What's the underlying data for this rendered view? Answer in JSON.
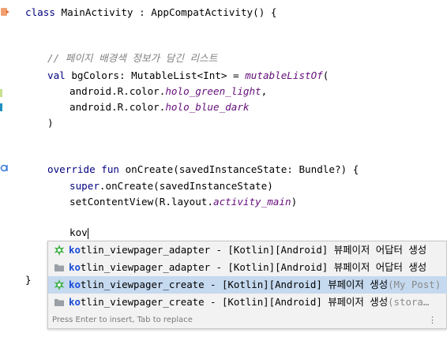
{
  "code": {
    "line_class": "class MainActivity : AppCompatActivity() {",
    "class_kw": "class",
    "class_rest": " MainActivity : AppCompatActivity() {",
    "comment": "// 페이지 배경색 정보가 담긴 리스트",
    "val_kw": "val",
    "val_rest": " bgColors: MutableList<Int> = ",
    "val_fn": "mutableListOf",
    "val_paren": "(",
    "color1_prefix": "android.R.color.",
    "color1_field": "holo_green_light",
    "color1_suffix": ",",
    "color2_prefix": "android.R.color.",
    "color2_field": "holo_blue_dark",
    "close_paren": ")",
    "override_kw": "override fun",
    "override_rest": " onCreate(savedInstanceState: Bundle?) {",
    "super_kw": "super",
    "super_rest": ".onCreate(savedInstanceState)",
    "setcontent_prefix": "setContentView(R.layout.",
    "setcontent_field": "activity_main",
    "setcontent_suffix": ")",
    "typed": "kov",
    "close_brace": "}"
  },
  "autocomplete": {
    "items": [
      {
        "match": "ko",
        "text": "tlin_viewpager_adapter - [Kotlin][Android] 뷰페이저 어답터 생성",
        "tail": "",
        "icon": "live-template-icon",
        "selected": false
      },
      {
        "match": "ko",
        "text": "tlin_viewpager_adapter - [Kotlin][Android] 뷰페이저 어답터 생성",
        "tail": "",
        "icon": "folder-icon",
        "selected": false
      },
      {
        "match": "ko",
        "text": "tlin_viewpager_create - [Kotlin][Android] 뷰페이저 생성",
        "tail": "(My Post)",
        "icon": "live-template-icon",
        "selected": true
      },
      {
        "match": "ko",
        "text": "tlin_viewpager_create - [Kotlin][Android] 뷰페이저 생성",
        "tail": "(stora…",
        "icon": "folder-icon",
        "selected": false
      }
    ],
    "hint": "Press Enter to insert, Tab to replace",
    "more_glyph": "⋮"
  },
  "colors": {
    "keyword": "#000080",
    "comment": "#808080",
    "field": "#660e7a",
    "selection": "#c5d9ef",
    "match": "#1a4bd8"
  }
}
